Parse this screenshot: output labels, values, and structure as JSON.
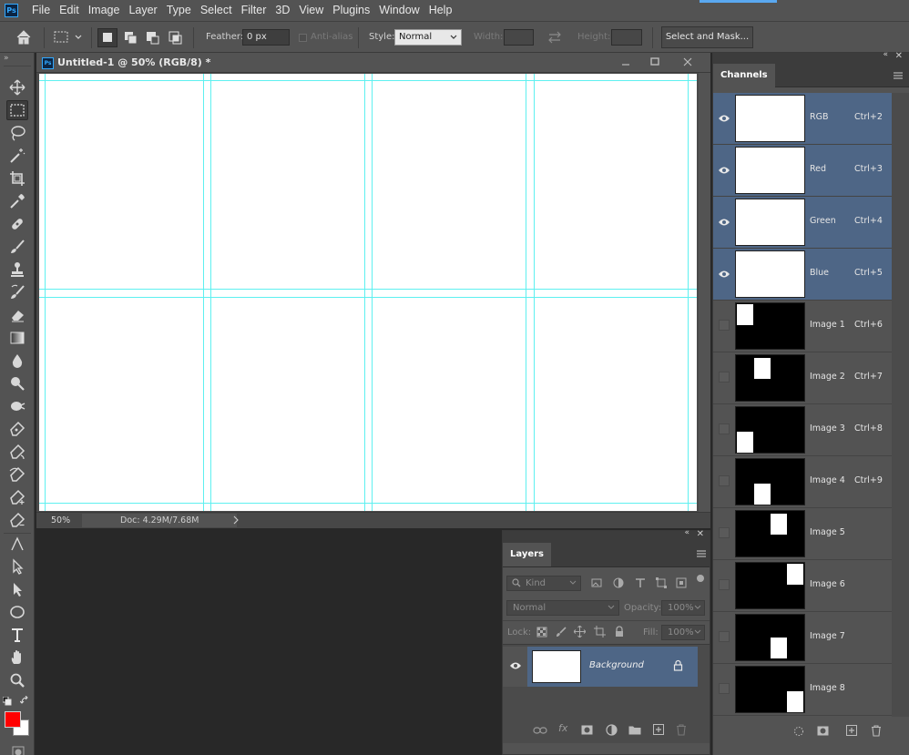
{
  "menu": {
    "app_logo": "Ps",
    "items": [
      "File",
      "Edit",
      "Image",
      "Layer",
      "Type",
      "Select",
      "Filter",
      "3D",
      "View",
      "Plugins",
      "Window",
      "Help"
    ]
  },
  "options": {
    "feather_label": "Feather:",
    "feather_value": "0 px",
    "antialias_label": "Anti-alias",
    "style_label": "Style:",
    "style_value": "Normal",
    "width_label": "Width:",
    "height_label": "Height:",
    "select_mask_label": "Select and Mask..."
  },
  "tools": [
    "move-icon",
    "marquee-icon",
    "lasso-icon",
    "magic-wand-icon",
    "crop-icon",
    "eyedropper-icon",
    "healing-icon",
    "brush-icon",
    "stamp-icon",
    "history-brush-icon",
    "eraser-icon",
    "gradient-icon",
    "blur-icon",
    "burn-icon",
    "dodge-icon",
    "pen-icon",
    "freeform-pen-icon",
    "curvature-pen-icon",
    "add-anchor-icon",
    "delete-anchor-icon",
    "path-selection-icon",
    "direct-selection-icon",
    "ellipse-icon",
    "type-icon",
    "hand-icon",
    "zoom-icon"
  ],
  "colors": {
    "foreground": "#ff0000",
    "background": "#ffffff",
    "guide": "#5ef0f0",
    "selected_row": "#4e6686"
  },
  "document": {
    "tab_logo": "Ps",
    "title": "Untitled-1 @ 50% (RGB/8) *",
    "zoom": "50%",
    "doc_info": "Doc: 4.29M/7.68M"
  },
  "layers": {
    "tab_label": "Layers",
    "kind_placeholder": "Kind",
    "blend_mode": "Normal",
    "opacity_label": "Opacity:",
    "opacity_value": "100%",
    "lock_label": "Lock:",
    "fill_label": "Fill:",
    "fill_value": "100%",
    "layer_name": "Background"
  },
  "channels": {
    "tab_label": "Channels",
    "rows": [
      {
        "name": "RGB",
        "shortcut": "Ctrl+2"
      },
      {
        "name": "Red",
        "shortcut": "Ctrl+3"
      },
      {
        "name": "Green",
        "shortcut": "Ctrl+4"
      },
      {
        "name": "Blue",
        "shortcut": "Ctrl+5"
      },
      {
        "name": "Image 1",
        "shortcut": "Ctrl+6"
      },
      {
        "name": "Image 2",
        "shortcut": "Ctrl+7"
      },
      {
        "name": "Image 3",
        "shortcut": "Ctrl+8"
      },
      {
        "name": "Image 4",
        "shortcut": "Ctrl+9"
      },
      {
        "name": "Image 5",
        "shortcut": ""
      },
      {
        "name": "Image 6",
        "shortcut": ""
      },
      {
        "name": "Image 7",
        "shortcut": ""
      },
      {
        "name": "Image 8",
        "shortcut": ""
      }
    ]
  }
}
